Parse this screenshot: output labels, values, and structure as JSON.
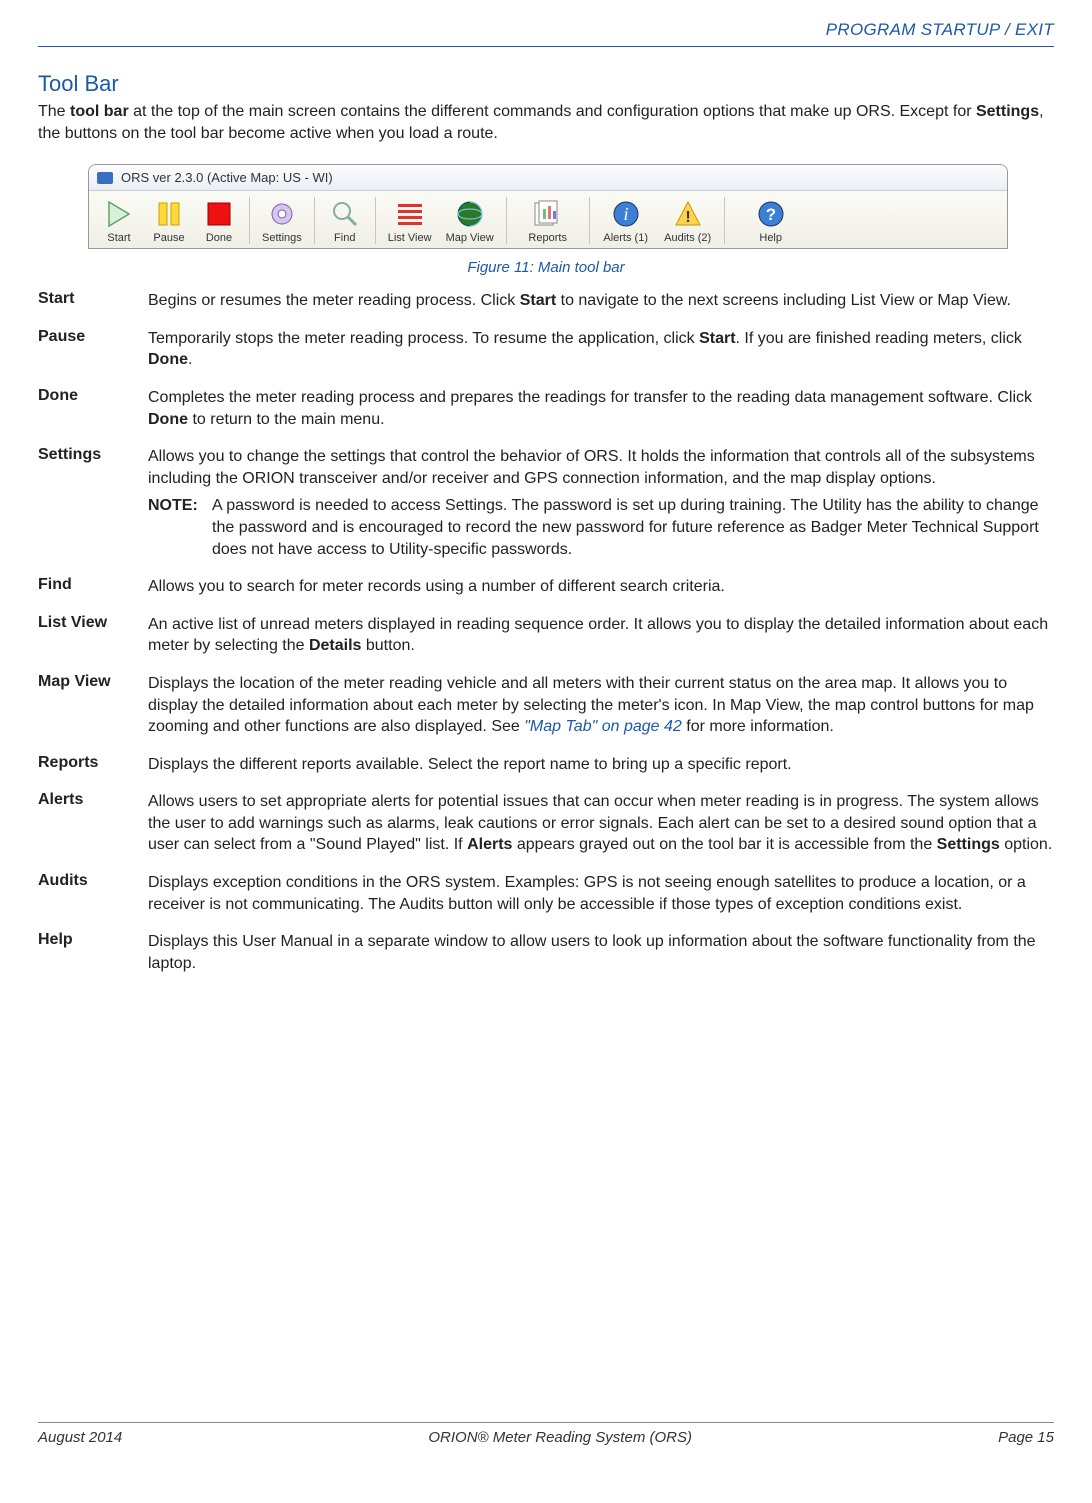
{
  "chapter_header": "PROGRAM STARTUP / EXIT",
  "section_title": "Tool Bar",
  "intro": {
    "t1": "The ",
    "b1": "tool bar",
    "t2": " at the top of the main screen contains the different commands and configuration options that make up ORS. Except for ",
    "b2": "Settings",
    "t3": ", the buttons on the tool bar become active when you load a route."
  },
  "titlebar_text": "ORS ver 2.3.0    (Active Map: US - WI)",
  "toolbar": {
    "start": "Start",
    "pause": "Pause",
    "done": "Done",
    "settings": "Settings",
    "find": "Find",
    "list_view": "List View",
    "map_view": "Map View",
    "reports": "Reports",
    "alerts": "Alerts (1)",
    "audits": "Audits (2)",
    "help": "Help"
  },
  "figure_caption": "Figure 11:  Main tool bar",
  "defs": {
    "start": {
      "term": "Start",
      "t1": "Begins or resumes the meter reading process. Click ",
      "b1": "Start",
      "t2": " to navigate to the next screens including List View or Map View."
    },
    "pause": {
      "term": "Pause",
      "t1": "Temporarily stops the meter reading process. To resume the application, click ",
      "b1": "Start",
      "t2": ". If you are finished reading meters, click ",
      "b2": "Done",
      "t3": "."
    },
    "done": {
      "term": "Done",
      "t1": "Completes the meter reading process and prepares the readings for transfer to the reading data management software. Click ",
      "b1": "Done",
      "t2": " to return to the main menu."
    },
    "settings": {
      "term": "Settings",
      "t1": "Allows you to change the settings that control the behavior of ORS. It holds the information that controls all of the subsystems including the ORION transceiver and/or receiver and GPS connection information, and the map display options.",
      "note_label": "NOTE:",
      "note_text": "A password is needed to access Settings. The password is set up during training. The Utility has the ability to change the password and is encouraged to record the new password for future reference as Badger Meter Technical Support does not have access to Utility-specific passwords."
    },
    "find": {
      "term": "Find",
      "t1": "Allows you to search for meter records using a number of different search criteria."
    },
    "list_view": {
      "term": "List View",
      "t1": "An active list of unread meters displayed in reading sequence order. It allows you to display the detailed information about each meter by selecting the ",
      "b1": "Details",
      "t2": " button."
    },
    "map_view": {
      "term": "Map View",
      "t1": "Displays the location of the meter reading vehicle and all meters with their current status on the area map. It allows you to display the detailed information about each meter by selecting the meter's icon. In Map View, the map control buttons for map zooming and other functions are also displayed. See ",
      "link": "\"Map Tab\" on page 42",
      "t2": " for more information."
    },
    "reports": {
      "term": "Reports",
      "t1": "Displays the different reports available. Select the report name to bring up a specific report."
    },
    "alerts": {
      "term": "Alerts",
      "t1": "Allows users to set appropriate alerts for potential issues that can occur when meter reading is in progress. The system allows the user to add warnings such as alarms, leak cautions or error signals. Each alert can be set to a desired sound option that a user can select from a \"Sound Played\" list. If ",
      "b1": "Alerts",
      "t2": " appears grayed out on the tool bar it is accessible from the ",
      "b2": "Settings",
      "t3": " option."
    },
    "audits": {
      "term": "Audits",
      "t1": "Displays exception conditions in the ORS system. Examples: GPS is not seeing enough satellites to produce a location, or a receiver is not communicating. The Audits button will only be accessible if those types of exception conditions exist."
    },
    "help": {
      "term": "Help",
      "t1": "Displays this User Manual in a separate window to allow users to look up information about the software functionality from the laptop."
    }
  },
  "footer": {
    "left": "August 2014",
    "center": "ORION® Meter Reading System (ORS)",
    "right": "Page 15"
  }
}
